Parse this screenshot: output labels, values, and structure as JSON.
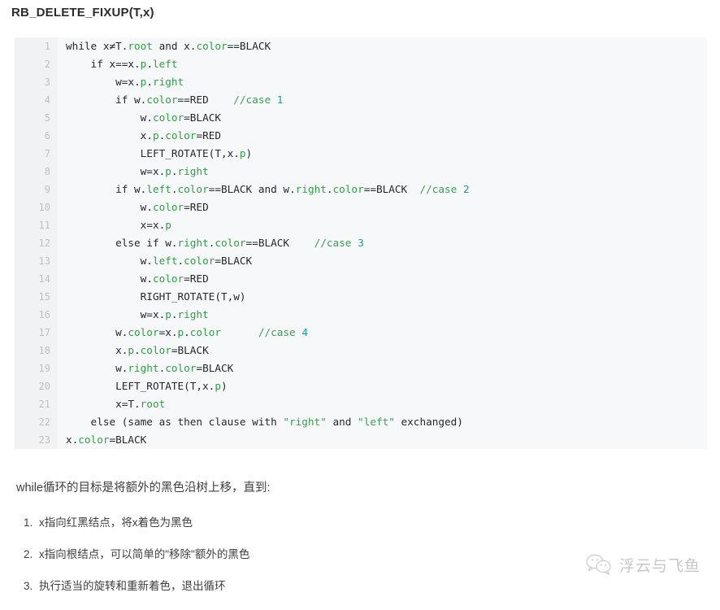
{
  "page_title": "RB_DELETE_FIXUP(T,x)",
  "code": {
    "background": "#f6f8fa",
    "gutter_background": "#f0f2f4",
    "accent_green": "#2f9e44",
    "accent_teal": "#1b9aaa",
    "lines": [
      {
        "n": "1",
        "tokens": [
          {
            "t": "while x≠T.",
            "c": "plain"
          },
          {
            "t": "root",
            "c": "prop"
          },
          {
            "t": " and x.",
            "c": "plain"
          },
          {
            "t": "color",
            "c": "prop"
          },
          {
            "t": "==BLACK",
            "c": "plain"
          }
        ]
      },
      {
        "n": "2",
        "tokens": [
          {
            "t": "    if x==x.",
            "c": "plain"
          },
          {
            "t": "p",
            "c": "prop"
          },
          {
            "t": ".",
            "c": "plain"
          },
          {
            "t": "left",
            "c": "prop"
          }
        ]
      },
      {
        "n": "3",
        "tokens": [
          {
            "t": "        w=x.",
            "c": "plain"
          },
          {
            "t": "p",
            "c": "prop"
          },
          {
            "t": ".",
            "c": "plain"
          },
          {
            "t": "right",
            "c": "prop"
          }
        ]
      },
      {
        "n": "4",
        "tokens": [
          {
            "t": "        if w.",
            "c": "plain"
          },
          {
            "t": "color",
            "c": "prop"
          },
          {
            "t": "==RED    ",
            "c": "plain"
          },
          {
            "t": "//case ",
            "c": "com"
          },
          {
            "t": "1",
            "c": "num"
          }
        ]
      },
      {
        "n": "5",
        "tokens": [
          {
            "t": "            w.",
            "c": "plain"
          },
          {
            "t": "color",
            "c": "prop"
          },
          {
            "t": "=BLACK",
            "c": "plain"
          }
        ]
      },
      {
        "n": "6",
        "tokens": [
          {
            "t": "            x.",
            "c": "plain"
          },
          {
            "t": "p",
            "c": "prop"
          },
          {
            "t": ".",
            "c": "plain"
          },
          {
            "t": "color",
            "c": "prop"
          },
          {
            "t": "=RED",
            "c": "plain"
          }
        ]
      },
      {
        "n": "7",
        "tokens": [
          {
            "t": "            LEFT_ROTATE(T,x.",
            "c": "plain"
          },
          {
            "t": "p",
            "c": "prop"
          },
          {
            "t": ")",
            "c": "plain"
          }
        ]
      },
      {
        "n": "8",
        "tokens": [
          {
            "t": "            w=x.",
            "c": "plain"
          },
          {
            "t": "p",
            "c": "prop"
          },
          {
            "t": ".",
            "c": "plain"
          },
          {
            "t": "right",
            "c": "prop"
          }
        ]
      },
      {
        "n": "9",
        "tokens": [
          {
            "t": "        if w.",
            "c": "plain"
          },
          {
            "t": "left",
            "c": "prop"
          },
          {
            "t": ".",
            "c": "plain"
          },
          {
            "t": "color",
            "c": "prop"
          },
          {
            "t": "==BLACK and w.",
            "c": "plain"
          },
          {
            "t": "right",
            "c": "prop"
          },
          {
            "t": ".",
            "c": "plain"
          },
          {
            "t": "color",
            "c": "prop"
          },
          {
            "t": "==BLACK  ",
            "c": "plain"
          },
          {
            "t": "//case ",
            "c": "com"
          },
          {
            "t": "2",
            "c": "num"
          }
        ]
      },
      {
        "n": "10",
        "tokens": [
          {
            "t": "            w.",
            "c": "plain"
          },
          {
            "t": "color",
            "c": "prop"
          },
          {
            "t": "=RED",
            "c": "plain"
          }
        ]
      },
      {
        "n": "11",
        "tokens": [
          {
            "t": "            x=x.",
            "c": "plain"
          },
          {
            "t": "p",
            "c": "prop"
          }
        ]
      },
      {
        "n": "12",
        "tokens": [
          {
            "t": "        else if w.",
            "c": "plain"
          },
          {
            "t": "right",
            "c": "prop"
          },
          {
            "t": ".",
            "c": "plain"
          },
          {
            "t": "color",
            "c": "prop"
          },
          {
            "t": "==BLACK    ",
            "c": "plain"
          },
          {
            "t": "//case ",
            "c": "com"
          },
          {
            "t": "3",
            "c": "num"
          }
        ]
      },
      {
        "n": "13",
        "tokens": [
          {
            "t": "            w.",
            "c": "plain"
          },
          {
            "t": "left",
            "c": "prop"
          },
          {
            "t": ".",
            "c": "plain"
          },
          {
            "t": "color",
            "c": "prop"
          },
          {
            "t": "=BLACK",
            "c": "plain"
          }
        ]
      },
      {
        "n": "14",
        "tokens": [
          {
            "t": "            w.",
            "c": "plain"
          },
          {
            "t": "color",
            "c": "prop"
          },
          {
            "t": "=RED",
            "c": "plain"
          }
        ]
      },
      {
        "n": "15",
        "tokens": [
          {
            "t": "            RIGHT_ROTATE(T,w)",
            "c": "plain"
          }
        ]
      },
      {
        "n": "16",
        "tokens": [
          {
            "t": "            w=x.",
            "c": "plain"
          },
          {
            "t": "p",
            "c": "prop"
          },
          {
            "t": ".",
            "c": "plain"
          },
          {
            "t": "right",
            "c": "prop"
          }
        ]
      },
      {
        "n": "17",
        "tokens": [
          {
            "t": "        w.",
            "c": "plain"
          },
          {
            "t": "color",
            "c": "prop"
          },
          {
            "t": "=x.",
            "c": "plain"
          },
          {
            "t": "p",
            "c": "prop"
          },
          {
            "t": ".",
            "c": "plain"
          },
          {
            "t": "color",
            "c": "prop"
          },
          {
            "t": "      ",
            "c": "plain"
          },
          {
            "t": "//case ",
            "c": "com"
          },
          {
            "t": "4",
            "c": "num"
          }
        ]
      },
      {
        "n": "18",
        "tokens": [
          {
            "t": "        x.",
            "c": "plain"
          },
          {
            "t": "p",
            "c": "prop"
          },
          {
            "t": ".",
            "c": "plain"
          },
          {
            "t": "color",
            "c": "prop"
          },
          {
            "t": "=BLACK",
            "c": "plain"
          }
        ]
      },
      {
        "n": "19",
        "tokens": [
          {
            "t": "        w.",
            "c": "plain"
          },
          {
            "t": "right",
            "c": "prop"
          },
          {
            "t": ".",
            "c": "plain"
          },
          {
            "t": "color",
            "c": "prop"
          },
          {
            "t": "=BLACK",
            "c": "plain"
          }
        ]
      },
      {
        "n": "20",
        "tokens": [
          {
            "t": "        LEFT_ROTATE(T,x.",
            "c": "plain"
          },
          {
            "t": "p",
            "c": "prop"
          },
          {
            "t": ")",
            "c": "plain"
          }
        ]
      },
      {
        "n": "21",
        "tokens": [
          {
            "t": "        x=T.",
            "c": "plain"
          },
          {
            "t": "root",
            "c": "prop"
          }
        ]
      },
      {
        "n": "22",
        "tokens": [
          {
            "t": "    else (same as then clause with ",
            "c": "plain"
          },
          {
            "t": "\"right\"",
            "c": "str"
          },
          {
            "t": " and ",
            "c": "plain"
          },
          {
            "t": "\"left\"",
            "c": "str"
          },
          {
            "t": " exchanged)",
            "c": "plain"
          }
        ]
      },
      {
        "n": "23",
        "tokens": [
          {
            "t": "x.",
            "c": "plain"
          },
          {
            "t": "color",
            "c": "prop"
          },
          {
            "t": "=BLACK",
            "c": "plain"
          }
        ]
      }
    ]
  },
  "prose": {
    "paragraph": "while循环的目标是将额外的黑色沿树上移，直到:",
    "list_items": [
      "x指向红黑结点，将x着色为黑色",
      "x指向根结点，可以简单的\"移除\"额外的黑色",
      "执行适当的旋转和重新着色，退出循环"
    ]
  },
  "watermark": {
    "text": "浮云与飞鱼",
    "logo_icon": "wechat-chat-bubbles-icon"
  }
}
